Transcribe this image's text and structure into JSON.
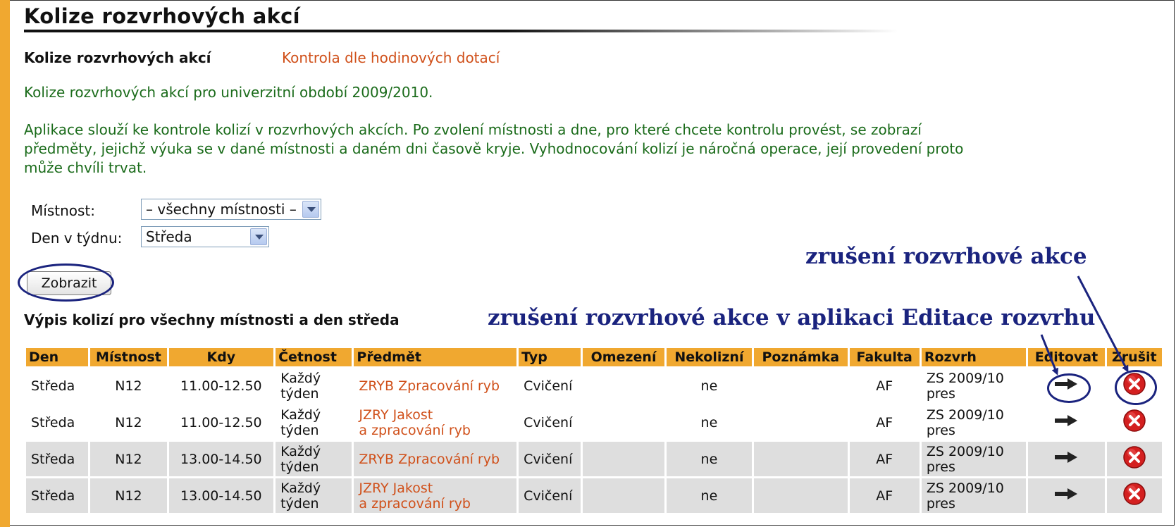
{
  "page": {
    "title": "Kolize rozvrhových akcí",
    "subnav_current": "Kolize rozvrhových akcí",
    "subnav_link": "Kontrola dle hodinových dotací",
    "intro": "Kolize rozvrhových akcí pro univerzitní období 2009/2010.",
    "description": "Aplikace slouží ke kontrole kolizí v rozvrhových akcích. Po zvolení místnosti a dne, pro které chcete kontrolu provést, se zobrazí předměty, jejichž výuka se v dané místnosti a daném dni časově kryje. Vyhodnocování kolizí je náročná operace, její provedení proto může chvíli trvat."
  },
  "form": {
    "room_label": "Místnost:",
    "room_value": "– všechny místnosti –",
    "day_label": "Den v týdnu:",
    "day_value": "Středa",
    "submit_label": "Zobrazit"
  },
  "results": {
    "title": "Výpis kolizí pro všechny místnosti a den středa",
    "headers": [
      "Den",
      "Místnost",
      "Kdy",
      "Četnost",
      "Předmět",
      "Typ",
      "Omezení",
      "Nekolizní",
      "Poznámka",
      "Fakulta",
      "Rozvrh",
      "Editovat",
      "Zrušit"
    ],
    "rows": [
      {
        "den": "Středa",
        "mistnost": "N12",
        "kdy": "11.00-12.50",
        "cetnost_1": "Každý",
        "cetnost_2": "týden",
        "predmet_1": "ZRYB Zpracování ryb",
        "predmet_2": "",
        "typ": "Cvičení",
        "omezeni": "",
        "nekolizni": "ne",
        "poznamka": "",
        "fakulta": "AF",
        "rozvrh_1": "ZS 2009/10",
        "rozvrh_2": "pres"
      },
      {
        "den": "Středa",
        "mistnost": "N12",
        "kdy": "11.00-12.50",
        "cetnost_1": "Každý",
        "cetnost_2": "týden",
        "predmet_1": "JZRY Jakost",
        "predmet_2": "a zpracování ryb",
        "typ": "Cvičení",
        "omezeni": "",
        "nekolizni": "ne",
        "poznamka": "",
        "fakulta": "AF",
        "rozvrh_1": "ZS 2009/10",
        "rozvrh_2": "pres"
      },
      {
        "den": "Středa",
        "mistnost": "N12",
        "kdy": "13.00-14.50",
        "cetnost_1": "Každý",
        "cetnost_2": "týden",
        "predmet_1": "ZRYB Zpracování ryb",
        "predmet_2": "",
        "typ": "Cvičení",
        "omezeni": "",
        "nekolizni": "ne",
        "poznamka": "",
        "fakulta": "AF",
        "rozvrh_1": "ZS 2009/10",
        "rozvrh_2": "pres"
      },
      {
        "den": "Středa",
        "mistnost": "N12",
        "kdy": "13.00-14.50",
        "cetnost_1": "Každý",
        "cetnost_2": "týden",
        "predmet_1": "JZRY Jakost",
        "predmet_2": "a zpracování ryb",
        "typ": "Cvičení",
        "omezeni": "",
        "nekolizni": "ne",
        "poznamka": "",
        "fakulta": "AF",
        "rozvrh_1": "ZS 2009/10",
        "rozvrh_2": "pres"
      }
    ]
  },
  "annotations": {
    "cancel_label": "zrušení rozvrhové akce",
    "edit_label": "zrušení rozvrhové akce v aplikaci Editace rozvrhu"
  },
  "colors": {
    "accent": "#f0a830",
    "link": "#d0501a",
    "info_text": "#1a6b1a",
    "annotation": "#1a237e",
    "row_alt": "#dedede"
  },
  "icons": {
    "edit": "arrow-right-icon",
    "cancel": "red-x-circle-icon",
    "select": "chevron-down-icon"
  }
}
